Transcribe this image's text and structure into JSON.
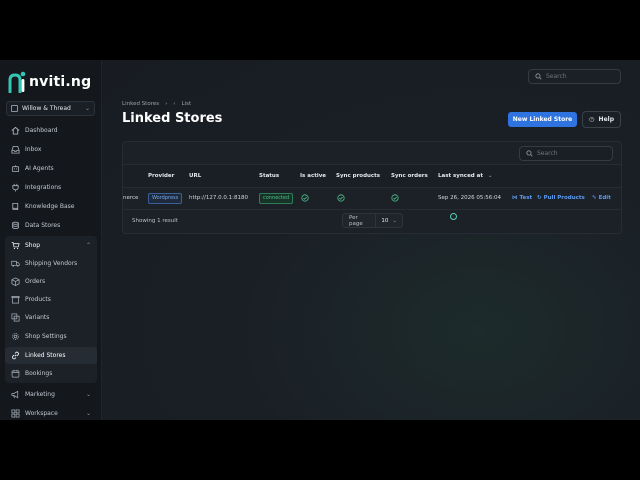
{
  "brand": {
    "name": "nviti.ng",
    "accent": "#2f73e0",
    "logo_teal": "#35c6b3"
  },
  "org": {
    "name": "Willow & Thread"
  },
  "top_search": {
    "placeholder": "Search"
  },
  "sidebar": {
    "items": [
      {
        "label": "Dashboard",
        "icon": "home-icon"
      },
      {
        "label": "Inbox",
        "icon": "inbox-icon"
      },
      {
        "label": "AI Agents",
        "icon": "bot-icon"
      },
      {
        "label": "Integrations",
        "icon": "plug-icon"
      },
      {
        "label": "Knowledge Base",
        "icon": "book-icon"
      },
      {
        "label": "Data Stores",
        "icon": "database-icon"
      }
    ],
    "shop": {
      "label": "Shop",
      "icon": "cart-icon",
      "children": [
        {
          "label": "Shipping Vendors",
          "icon": "truck-icon"
        },
        {
          "label": "Orders",
          "icon": "package-icon"
        },
        {
          "label": "Products",
          "icon": "box-icon"
        },
        {
          "label": "Variants",
          "icon": "layers-icon"
        },
        {
          "label": "Shop Settings",
          "icon": "gear-icon"
        },
        {
          "label": "Linked Stores",
          "icon": "link-icon",
          "active": true
        },
        {
          "label": "Bookings",
          "icon": "calendar-icon"
        }
      ]
    },
    "bottom": [
      {
        "label": "Marketing",
        "icon": "megaphone-icon"
      },
      {
        "label": "Workspace",
        "icon": "grid-icon"
      }
    ]
  },
  "breadcrumb": {
    "parent": "Linked Stores",
    "current": "List"
  },
  "page": {
    "title": "Linked Stores"
  },
  "actions": {
    "new_label": "New Linked Store",
    "help_label": "Help"
  },
  "table": {
    "search_placeholder": "Search",
    "columns": [
      "Provider",
      "URL",
      "Status",
      "Is active",
      "Sync products",
      "Sync orders",
      "Last synced at"
    ],
    "rows": [
      {
        "name": "nerce",
        "provider": "Wordpress",
        "url": "http://127.0.0.1:8180",
        "status": "connected",
        "is_active": true,
        "sync_products": true,
        "sync_orders": true,
        "last_synced_at": "Sep 26, 2026 05:56:04",
        "actions": [
          "Test",
          "Pull Products",
          "Edit"
        ]
      }
    ],
    "footer": {
      "result_text": "Showing 1 result",
      "per_page_label": "Per page",
      "per_page_value": "10"
    }
  }
}
